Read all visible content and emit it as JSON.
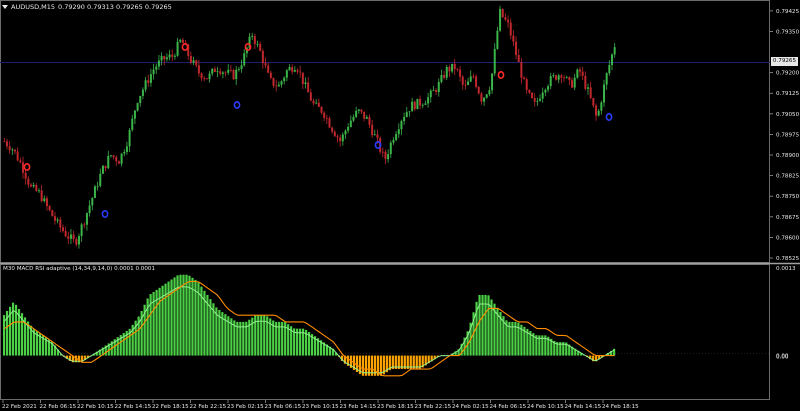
{
  "window": {
    "symbol_title": "AUDUSD,M15",
    "ohlc": "0.79290 0.79313 0.79265 0.79265"
  },
  "indicator": {
    "label": "M30 MACD RSI adaptive (14,34,9,14,0) 0.0001 0.0001"
  },
  "current_price": "0.79265",
  "price_axis": {
    "ticks": [
      "0.79425",
      "0.79350",
      "0.79200",
      "0.79125",
      "0.79050",
      "0.78975",
      "0.78900",
      "0.78825",
      "0.78750",
      "0.78675",
      "0.78600",
      "0.78525"
    ]
  },
  "indicator_axis": {
    "ticks": [
      "0.0013",
      "0.00",
      "0.00"
    ]
  },
  "time_axis": {
    "labels": [
      "22 Feb 2021",
      "22 Feb 06:15",
      "22 Feb 10:15",
      "22 Feb 14:15",
      "22 Feb 18:15",
      "22 Feb 22:15",
      "23 Feb 02:15",
      "23 Feb 06:15",
      "23 Feb 10:15",
      "23 Feb 14:15",
      "23 Feb 18:15",
      "23 Feb 22:15",
      "24 Feb 02:15",
      "24 Feb 06:15",
      "24 Feb 10:15",
      "24 Feb 14:15",
      "24 Feb 18:15"
    ]
  },
  "colors": {
    "background": "#000000",
    "bull_candle": "#3bb54a",
    "bear_candle": "#c0282d",
    "hist_positive": "#4cd046",
    "hist_negative": "#ffa500",
    "signal_line": "#ff8c00",
    "macd_line": "#90ee90",
    "grid_line": "#1e1e6e",
    "fractal_up": "#ff2a2a",
    "fractal_down": "#2a3cff"
  },
  "chart_data": [
    {
      "type": "candlestick",
      "title": "AUDUSD,M15",
      "close_path": [
        0.7895,
        0.7892,
        0.7886,
        0.7878,
        0.7876,
        0.787,
        0.7865,
        0.7861,
        0.7858,
        0.7866,
        0.7875,
        0.7884,
        0.789,
        0.7888,
        0.7896,
        0.791,
        0.7916,
        0.7922,
        0.7925,
        0.7926,
        0.7932,
        0.7925,
        0.792,
        0.7918,
        0.7922,
        0.792,
        0.7919,
        0.7925,
        0.7934,
        0.7927,
        0.7917,
        0.7915,
        0.7921,
        0.7923,
        0.7915,
        0.7908,
        0.7906,
        0.79,
        0.7895,
        0.7902,
        0.7906,
        0.7903,
        0.7896,
        0.7888,
        0.7897,
        0.7904,
        0.7908,
        0.7909,
        0.7911,
        0.7915,
        0.7921,
        0.7922,
        0.7914,
        0.7919,
        0.791,
        0.7916,
        0.7942,
        0.7937,
        0.7925,
        0.7913,
        0.7908,
        0.7915,
        0.7918,
        0.792,
        0.7915,
        0.7921,
        0.7913,
        0.7903,
        0.7918,
        0.793
      ],
      "ylim": [
        0.78525,
        0.7945
      ]
    },
    {
      "type": "bar",
      "title": "M30 MACD RSI adaptive (14,34,9,14,0) 0.0001 0.0001",
      "values": [
        0.0006,
        0.0008,
        0.0006,
        0.0004,
        0.0003,
        0.0002,
        0.0,
        -0.0001,
        -0.0001,
        0.0,
        0.0001,
        0.0002,
        0.0003,
        0.0004,
        0.0006,
        0.0009,
        0.001,
        0.0011,
        0.0012,
        0.0012,
        0.0011,
        0.0009,
        0.0007,
        0.0006,
        0.0005,
        0.0005,
        0.0006,
        0.0006,
        0.0005,
        0.0005,
        0.0004,
        0.0004,
        0.0003,
        0.0002,
        0.0001,
        -0.0001,
        -0.0002,
        -0.0003,
        -0.0003,
        -0.0003,
        -0.0002,
        -0.0002,
        -0.0002,
        -0.0002,
        -0.0001,
        0.0,
        0.0,
        0.0001,
        0.0004,
        0.0009,
        0.0009,
        0.0007,
        0.0005,
        0.0005,
        0.0004,
        0.0003,
        0.0003,
        0.0002,
        0.0002,
        0.0001,
        0.0,
        -0.0001,
        0.0,
        0.0001
      ],
      "signal": [
        0.0004,
        0.0005,
        0.0005,
        0.0004,
        0.0003,
        0.0002,
        0.0001,
        0.0,
        -0.0001,
        -0.0001,
        0.0,
        0.0001,
        0.0002,
        0.0003,
        0.0004,
        0.0006,
        0.0008,
        0.0009,
        0.001,
        0.0011,
        0.0011,
        0.001,
        0.0009,
        0.0007,
        0.0006,
        0.0006,
        0.0006,
        0.0006,
        0.0006,
        0.0005,
        0.0005,
        0.0005,
        0.0004,
        0.0003,
        0.0002,
        0.0,
        -0.0001,
        -0.0002,
        -0.0002,
        -0.0003,
        -0.0003,
        -0.0003,
        -0.0002,
        -0.0002,
        -0.0002,
        -0.0001,
        0.0,
        0.0,
        0.0002,
        0.0005,
        0.0007,
        0.0007,
        0.0006,
        0.0005,
        0.0005,
        0.0004,
        0.0004,
        0.0003,
        0.0003,
        0.0002,
        0.0001,
        0.0,
        0.0,
        0.0
      ],
      "ylim": [
        -0.0006,
        0.0013
      ]
    }
  ]
}
